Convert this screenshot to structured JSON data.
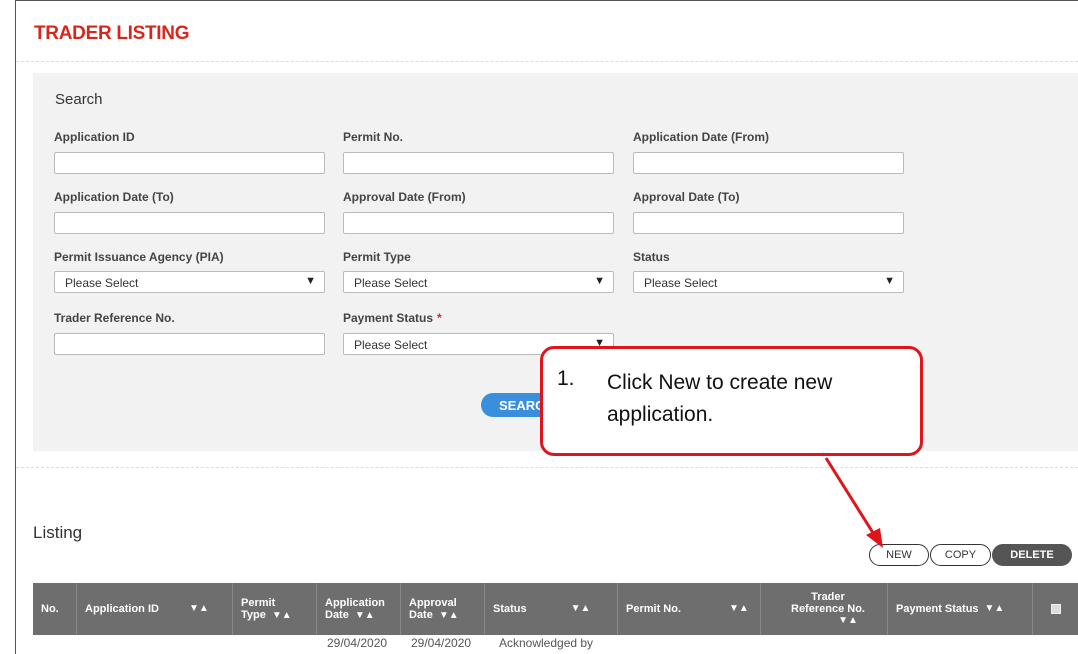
{
  "page": {
    "title": "TRADER LISTING"
  },
  "search": {
    "title": "Search",
    "fields": {
      "application_id": {
        "label": "Application ID",
        "value": ""
      },
      "permit_no": {
        "label": "Permit No.",
        "value": ""
      },
      "app_date_from": {
        "label": "Application Date (From)",
        "value": ""
      },
      "app_date_to": {
        "label": "Application Date (To)",
        "value": ""
      },
      "approval_date_from": {
        "label": "Approval Date (From)",
        "value": ""
      },
      "approval_date_to": {
        "label": "Approval Date (To)",
        "value": ""
      },
      "pia": {
        "label": "Permit Issuance Agency (PIA)",
        "value": "Please Select"
      },
      "permit_type": {
        "label": "Permit Type",
        "value": "Please Select"
      },
      "status": {
        "label": "Status",
        "value": "Please Select"
      },
      "trader_ref": {
        "label": "Trader Reference No.",
        "value": ""
      },
      "payment_status": {
        "label": "Payment Status",
        "required_mark": "*",
        "value": "Please Select"
      }
    },
    "search_button": "SEARCH"
  },
  "listing": {
    "title": "Listing",
    "buttons": {
      "new": "NEW",
      "copy": "COPY",
      "delete": "DELETE"
    },
    "sort_glyph": "▼▲",
    "columns": {
      "no": "No.",
      "application_id": "Application ID",
      "permit_type_1": "Permit",
      "permit_type_2": "Type",
      "app_date_1": "Application",
      "app_date_2": "Date",
      "approval_date_1": "Approval",
      "approval_date_2": "Date",
      "status": "Status",
      "permit_no": "Permit No.",
      "trader_ref_1": "Trader",
      "trader_ref_2": "Reference No.",
      "payment_status": "Payment Status"
    },
    "first_row": {
      "application_date": "29/04/2020",
      "approval_date": "29/04/2020",
      "status": "Acknowledged by"
    }
  },
  "callout": {
    "number": "1.",
    "text": "Click New to create new application.",
    "border_color": "#e0141b"
  },
  "colors": {
    "title_red": "#d9261c",
    "search_blue": "#3a8fdc",
    "table_header_gray": "#6e6e6e"
  }
}
